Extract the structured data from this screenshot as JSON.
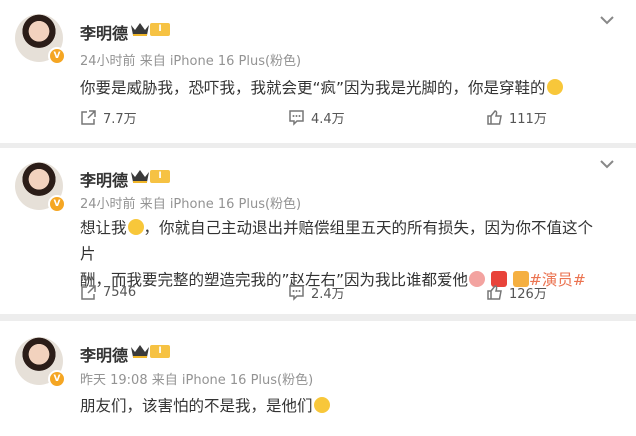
{
  "posts": [
    {
      "author": "李明德",
      "level": "I",
      "time": "24小时前",
      "source": "来自 iPhone 16 Plus(粉色)",
      "text": "你要是威胁我，恐吓我，我就会更“疯”因为我是光脚的，你是穿鞋的",
      "shares": "7.7万",
      "comments": "4.4万",
      "likes": "111万"
    },
    {
      "author": "李明德",
      "level": "I",
      "time": "24小时前",
      "source": "来自 iPhone 16 Plus(粉色)",
      "text_line1_a": "想让我",
      "text_line1_b": "，你就自己主动退出并赔偿组里五天的所有损失，因为你不值这个片",
      "text_line2": "酬，而我要完整的塑造完我的”赵左右”因为我比谁都爱他",
      "hashtag": "#演员#",
      "shares": "7546",
      "comments": "2.4万",
      "likes": "126万"
    },
    {
      "author": "李明德",
      "level": "I",
      "time": "昨天 19:08",
      "source": "来自 iPhone 16 Plus(粉色)",
      "text": "朋友们，该害怕的不是我，是他们"
    }
  ],
  "icons": {
    "share": "share-icon",
    "comment": "comment-icon",
    "like": "like-icon",
    "menu": "chevron-down-icon",
    "verified": "verified-badge-icon",
    "crown": "crown-icon"
  },
  "colors": {
    "accent": "#eb7350",
    "meta": "#939393",
    "badge": "#f5a623"
  }
}
